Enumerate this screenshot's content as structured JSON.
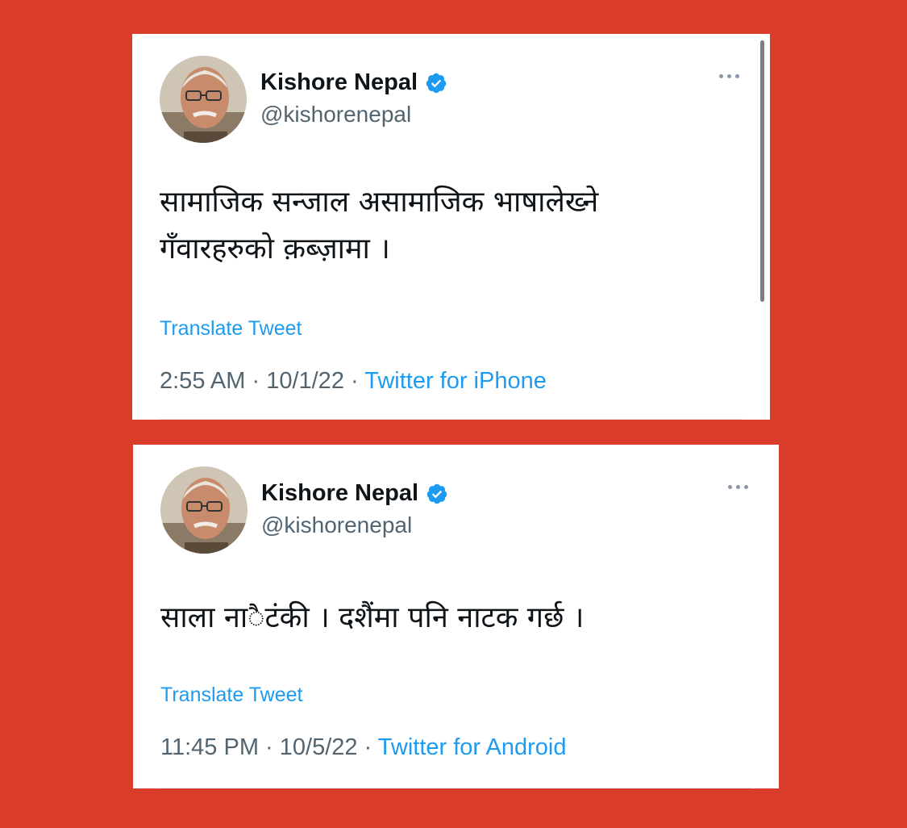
{
  "tweets": [
    {
      "name": "Kishore Nepal",
      "handle": "@kishorenepal",
      "text": "सामाजिक सन्जाल असामाजिक भाषालेख्ने\nगँवारहरुको क़ब्ज़ामा ।",
      "translate_label": "Translate Tweet",
      "time": "2:55 AM",
      "date": "10/1/22",
      "source": "Twitter for iPhone"
    },
    {
      "name": "Kishore Nepal",
      "handle": "@kishorenepal",
      "text": "साला ना◌ैटंकी । दशैंमा पनि नाटक गर्छ ।",
      "translate_label": "Translate Tweet",
      "time": "11:45 PM",
      "date": "10/5/22",
      "source": "Twitter for Android"
    }
  ],
  "separator": " · ",
  "colors": {
    "background": "#d93c28",
    "link": "#1d9bf0",
    "verified": "#1d9bf0",
    "secondary_text": "#536471"
  },
  "icons": {
    "verified": "verified-badge-icon",
    "more": "more-options-icon"
  }
}
